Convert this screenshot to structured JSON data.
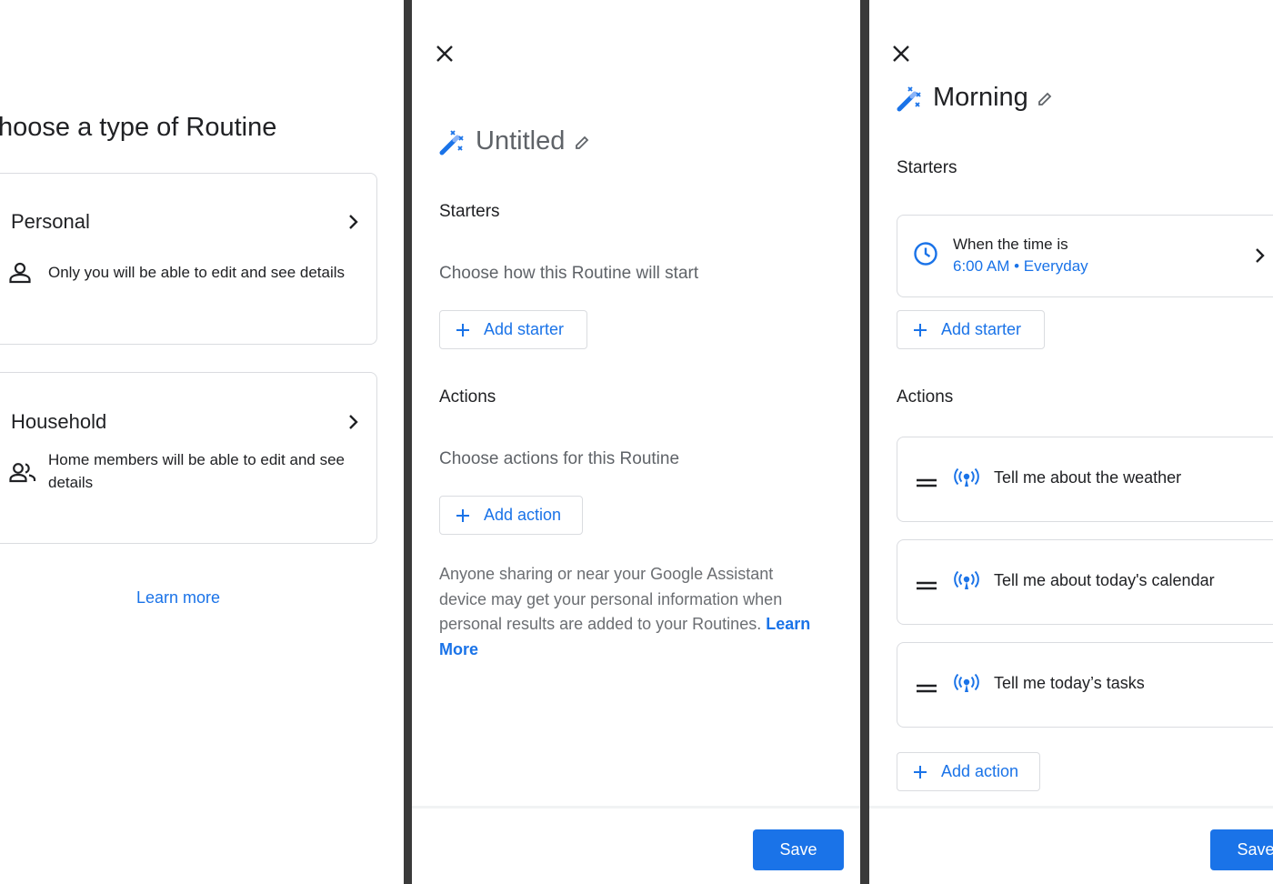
{
  "panel1": {
    "title": "hoose a type of Routine",
    "cards": [
      {
        "title": "Personal",
        "description": "Only you will be able to edit and see details"
      },
      {
        "title": "Household",
        "description_line1": "Home members will be able to edit and see",
        "description_line2": "details"
      }
    ],
    "learn_more": "Learn more"
  },
  "panel2": {
    "routine_name": "Untitled",
    "starters_heading": "Starters",
    "starters_helper": "Choose how this Routine will start",
    "add_starter": "Add starter",
    "actions_heading": "Actions",
    "actions_helper": "Choose actions for this Routine",
    "add_action": "Add action",
    "disclaimer_lines": [
      "Anyone sharing or near your Google Assistant",
      "device may get your personal information when",
      "personal results are added to your Routines."
    ],
    "disclaimer_link_1": "Learn",
    "disclaimer_link_2": "More",
    "save": "Save"
  },
  "panel3": {
    "routine_name": "Morning",
    "starters_heading": "Starters",
    "starter": {
      "title": "When the time is",
      "time": "6:00 AM",
      "separator": "•",
      "repeat": "Everyday"
    },
    "add_starter": "Add starter",
    "actions_heading": "Actions",
    "actions": [
      {
        "label": "Tell me about the weather"
      },
      {
        "label": "Tell me about today's calendar"
      },
      {
        "label": "Tell me today’s tasks"
      }
    ],
    "add_action": "Add action",
    "save": "Save"
  },
  "colors": {
    "accent": "#1a73e8",
    "border": "#dadce0",
    "text": "#202124",
    "secondary": "#5f6368"
  },
  "icons": [
    "close-icon",
    "routine-wand-icon",
    "edit-pencil-icon",
    "chevron-right-icon",
    "person-icon",
    "people-icon",
    "plus-icon",
    "clock-icon",
    "drag-handle-icon",
    "broadcast-icon"
  ]
}
